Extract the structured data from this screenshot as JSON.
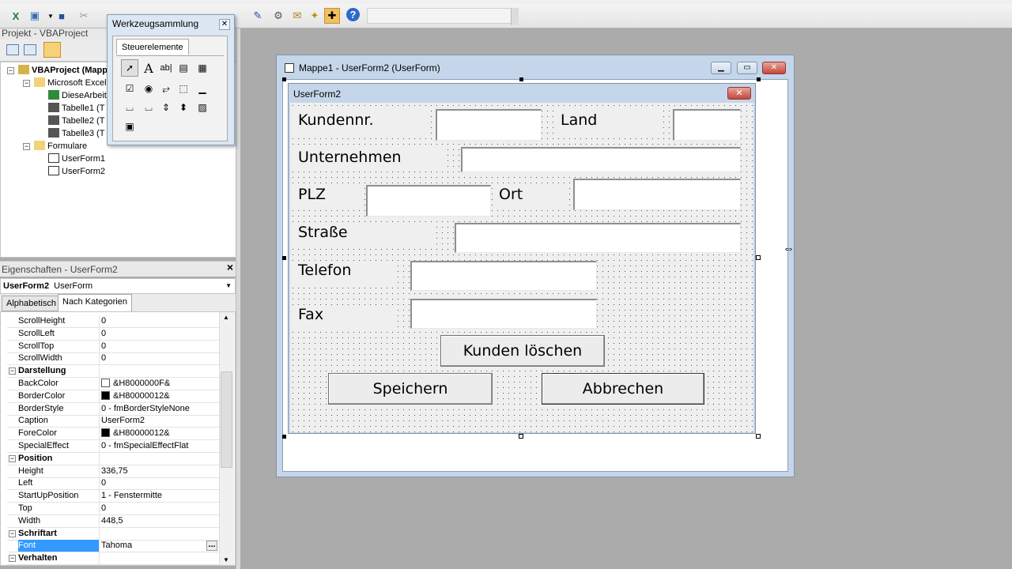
{
  "project_pane": {
    "title": "Projekt - VBAProject",
    "tree": [
      {
        "label": "VBAProject (Mapp"
      },
      {
        "label": "Microsoft Excel"
      },
      {
        "label": "DieseArbeit"
      },
      {
        "label": "Tabelle1 (T"
      },
      {
        "label": "Tabelle2 (T"
      },
      {
        "label": "Tabelle3 (T"
      },
      {
        "label": "Formulare"
      },
      {
        "label": "UserForm1"
      },
      {
        "label": "UserForm2"
      }
    ]
  },
  "toolbox": {
    "title": "Werkzeugsammlung",
    "tab": "Steuerelemente",
    "tools": [
      "pointer-icon",
      "label-A-icon",
      "textbox-ab-icon",
      "combobox-icon",
      "listbox-icon",
      "checkbox-icon",
      "optionbutton-icon",
      "togglebutton-icon",
      "frame-icon",
      "commandbutton-icon",
      "tabstrip-icon",
      "multipage-icon",
      "scrollbar-icon",
      "spinbutton-icon",
      "image-icon",
      "refedit-icon"
    ]
  },
  "properties": {
    "title": "Eigenschaften - UserForm2",
    "object_name": "UserForm2",
    "object_type": "UserForm",
    "tabs": [
      "Alphabetisch",
      "Nach Kategorien"
    ],
    "rows": [
      {
        "name": "ScrollHeight",
        "value": "0"
      },
      {
        "name": "ScrollLeft",
        "value": "0"
      },
      {
        "name": "ScrollTop",
        "value": "0"
      },
      {
        "name": "ScrollWidth",
        "value": "0"
      },
      {
        "name": "Darstellung",
        "value": "",
        "category": true
      },
      {
        "name": "BackColor",
        "value": "&H8000000F&",
        "swatch": "#ffffff"
      },
      {
        "name": "BorderColor",
        "value": "&H80000012&",
        "swatch": "#000000"
      },
      {
        "name": "BorderStyle",
        "value": "0 - fmBorderStyleNone"
      },
      {
        "name": "Caption",
        "value": "UserForm2"
      },
      {
        "name": "ForeColor",
        "value": "&H80000012&",
        "swatch": "#000000"
      },
      {
        "name": "SpecialEffect",
        "value": "0 - fmSpecialEffectFlat"
      },
      {
        "name": "Position",
        "value": "",
        "category": true
      },
      {
        "name": "Height",
        "value": "336,75"
      },
      {
        "name": "Left",
        "value": "0"
      },
      {
        "name": "StartUpPosition",
        "value": "1 - Fenstermitte"
      },
      {
        "name": "Top",
        "value": "0"
      },
      {
        "name": "Width",
        "value": "448,5"
      },
      {
        "name": "Schriftart",
        "value": "",
        "category": true
      },
      {
        "name": "Font",
        "value": "Tahoma",
        "selected": true
      },
      {
        "name": "Verhalten",
        "value": "",
        "category": true
      }
    ],
    "font_button": "..."
  },
  "workbook_window": {
    "title": "Mappe1 - UserForm2 (UserForm)"
  },
  "userform": {
    "caption": "UserForm2",
    "labels": {
      "kundennr": "Kundennr.",
      "land": "Land",
      "unternehmen": "Unternehmen",
      "plz": "PLZ",
      "ort": "Ort",
      "strasse": "Straße",
      "telefon": "Telefon",
      "fax": "Fax"
    },
    "buttons": {
      "kunden_loeschen": "Kunden löschen",
      "speichern": "Speichern",
      "abbrechen": "Abbrechen"
    }
  },
  "colors": {
    "selection": "#3399ff",
    "window_frame": "#c5d6ea",
    "close_red": "#c7463a"
  }
}
